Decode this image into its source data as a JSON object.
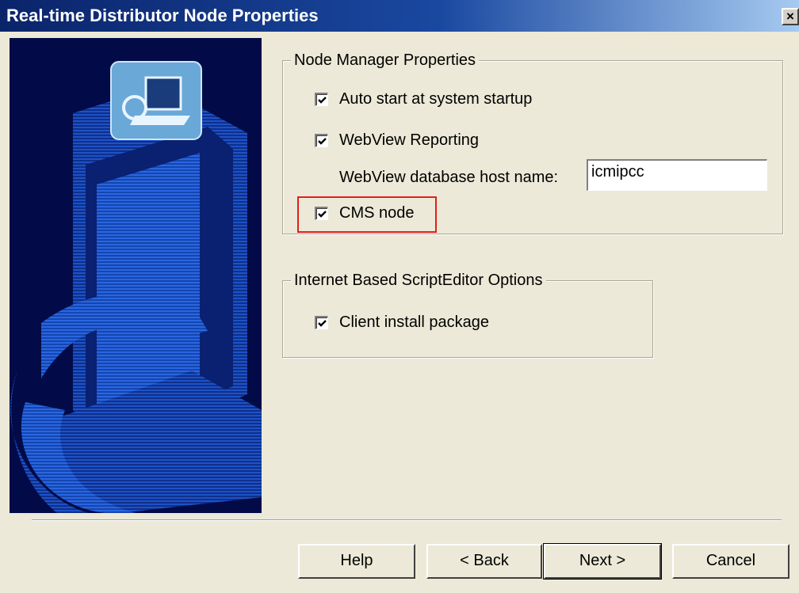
{
  "window": {
    "title": "Real-time Distributor Node Properties",
    "close_glyph": "×"
  },
  "node_manager": {
    "legend": "Node Manager Properties",
    "auto_start": {
      "label": "Auto start at system startup",
      "checked": true
    },
    "webview_reporting": {
      "label": "WebView Reporting",
      "checked": true
    },
    "db_host": {
      "label": "WebView database host name:",
      "value": "icmipcc"
    },
    "cms_node": {
      "label": "CMS node",
      "checked": true
    }
  },
  "script_editor": {
    "legend": "Internet Based ScriptEditor Options",
    "client_install": {
      "label": "Client install package",
      "checked": true
    }
  },
  "buttons": {
    "help": "Help",
    "back": "< Back",
    "next": "Next >",
    "cancel": "Cancel"
  },
  "colors": {
    "title_bar": "#0a246a",
    "dialog_bg": "#ece9d8",
    "highlight": "#e0201a",
    "art_bg": "#020b48"
  },
  "icons": [
    "computer-icon",
    "checkmark-icon",
    "close-icon"
  ]
}
